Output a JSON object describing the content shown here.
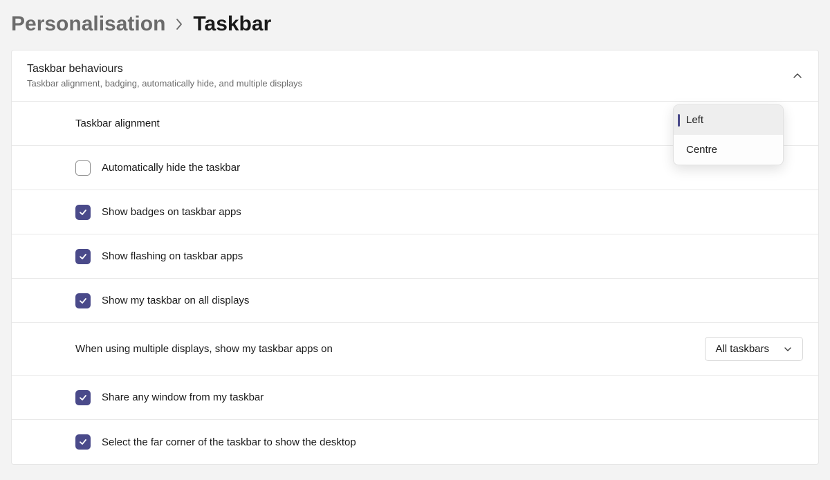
{
  "breadcrumb": {
    "parent": "Personalisation",
    "current": "Taskbar"
  },
  "section": {
    "title": "Taskbar behaviours",
    "subtitle": "Taskbar alignment, badging, automatically hide, and multiple displays"
  },
  "alignment": {
    "label": "Taskbar alignment",
    "options": {
      "left": "Left",
      "centre": "Centre"
    }
  },
  "checkboxes": {
    "autohide": "Automatically hide the taskbar",
    "badges": "Show badges on taskbar apps",
    "flashing": "Show flashing on taskbar apps",
    "alldisplays": "Show my taskbar on all displays",
    "sharewindow": "Share any window from my taskbar",
    "farcorner": "Select the far corner of the taskbar to show the desktop"
  },
  "multidisplay": {
    "label": "When using multiple displays, show my taskbar apps on",
    "selected": "All taskbars"
  }
}
